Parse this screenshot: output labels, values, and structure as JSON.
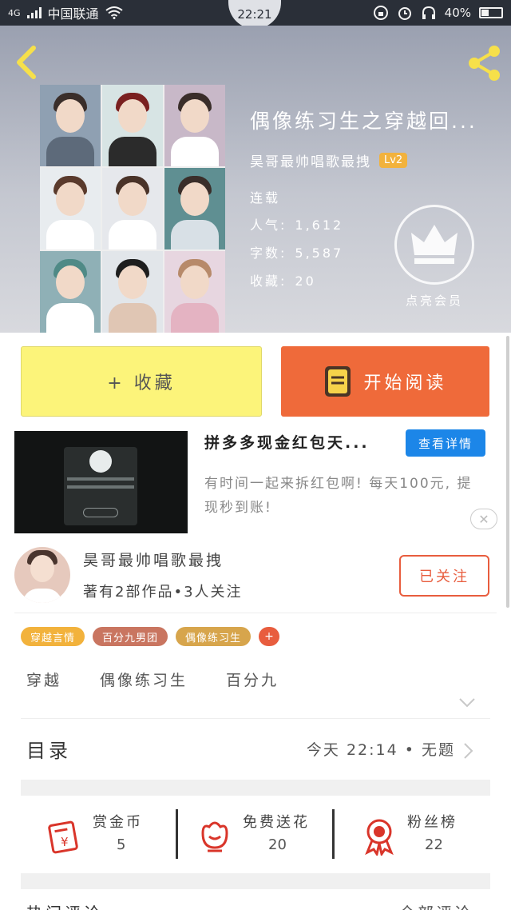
{
  "status_bar": {
    "network": "4G",
    "carrier": "中国联通",
    "time": "22:21",
    "battery": "40%"
  },
  "book": {
    "title": "偶像练习生之穿越回...",
    "author": "昊哥最帅唱歌最拽",
    "level": "Lv2",
    "status": "连载",
    "popularity_label": "人气:",
    "popularity": "1,612",
    "words_label": "字数:",
    "words": "5,587",
    "favorites_label": "收藏:",
    "favorites": "20"
  },
  "vip": {
    "label": "点亮会员"
  },
  "actions": {
    "collect_label": "+ 收藏",
    "read_label": "开始阅读"
  },
  "ad": {
    "title": "拼多多现金红包天...",
    "button": "查看详情",
    "description": "有时间一起来拆红包啊! 每天100元, 提现秒到账!",
    "close": "✕"
  },
  "author_card": {
    "name": "昊哥最帅唱歌最拽",
    "meta": "著有2部作品•3人关注",
    "follow_label": "已关注"
  },
  "tags": [
    {
      "label": "穿越言情",
      "color": "#f2b23c"
    },
    {
      "label": "百分九男团",
      "color": "#c97560"
    },
    {
      "label": "偶像练习生",
      "color": "#d7a54c"
    }
  ],
  "tag_add": "+",
  "keywords": [
    "穿越",
    "偶像练习生",
    "百分九"
  ],
  "toc": {
    "title": "目录",
    "latest": "今天 22:14 • 无题"
  },
  "rewards": [
    {
      "label": "赏金币",
      "value": "5",
      "icon": "red-envelope-icon"
    },
    {
      "label": "免费送花",
      "value": "20",
      "icon": "flower-icon"
    },
    {
      "label": "粉丝榜",
      "value": "22",
      "icon": "medal-icon"
    }
  ],
  "bottom_peek": {
    "left": "热门评论",
    "right": "全部评论"
  },
  "colors": {
    "accent_orange": "#ef6a3a",
    "collect_yellow": "#fcf47a",
    "ad_blue": "#1c86e8",
    "level_gold": "#f2b23c",
    "reward_red": "#d9352a"
  }
}
